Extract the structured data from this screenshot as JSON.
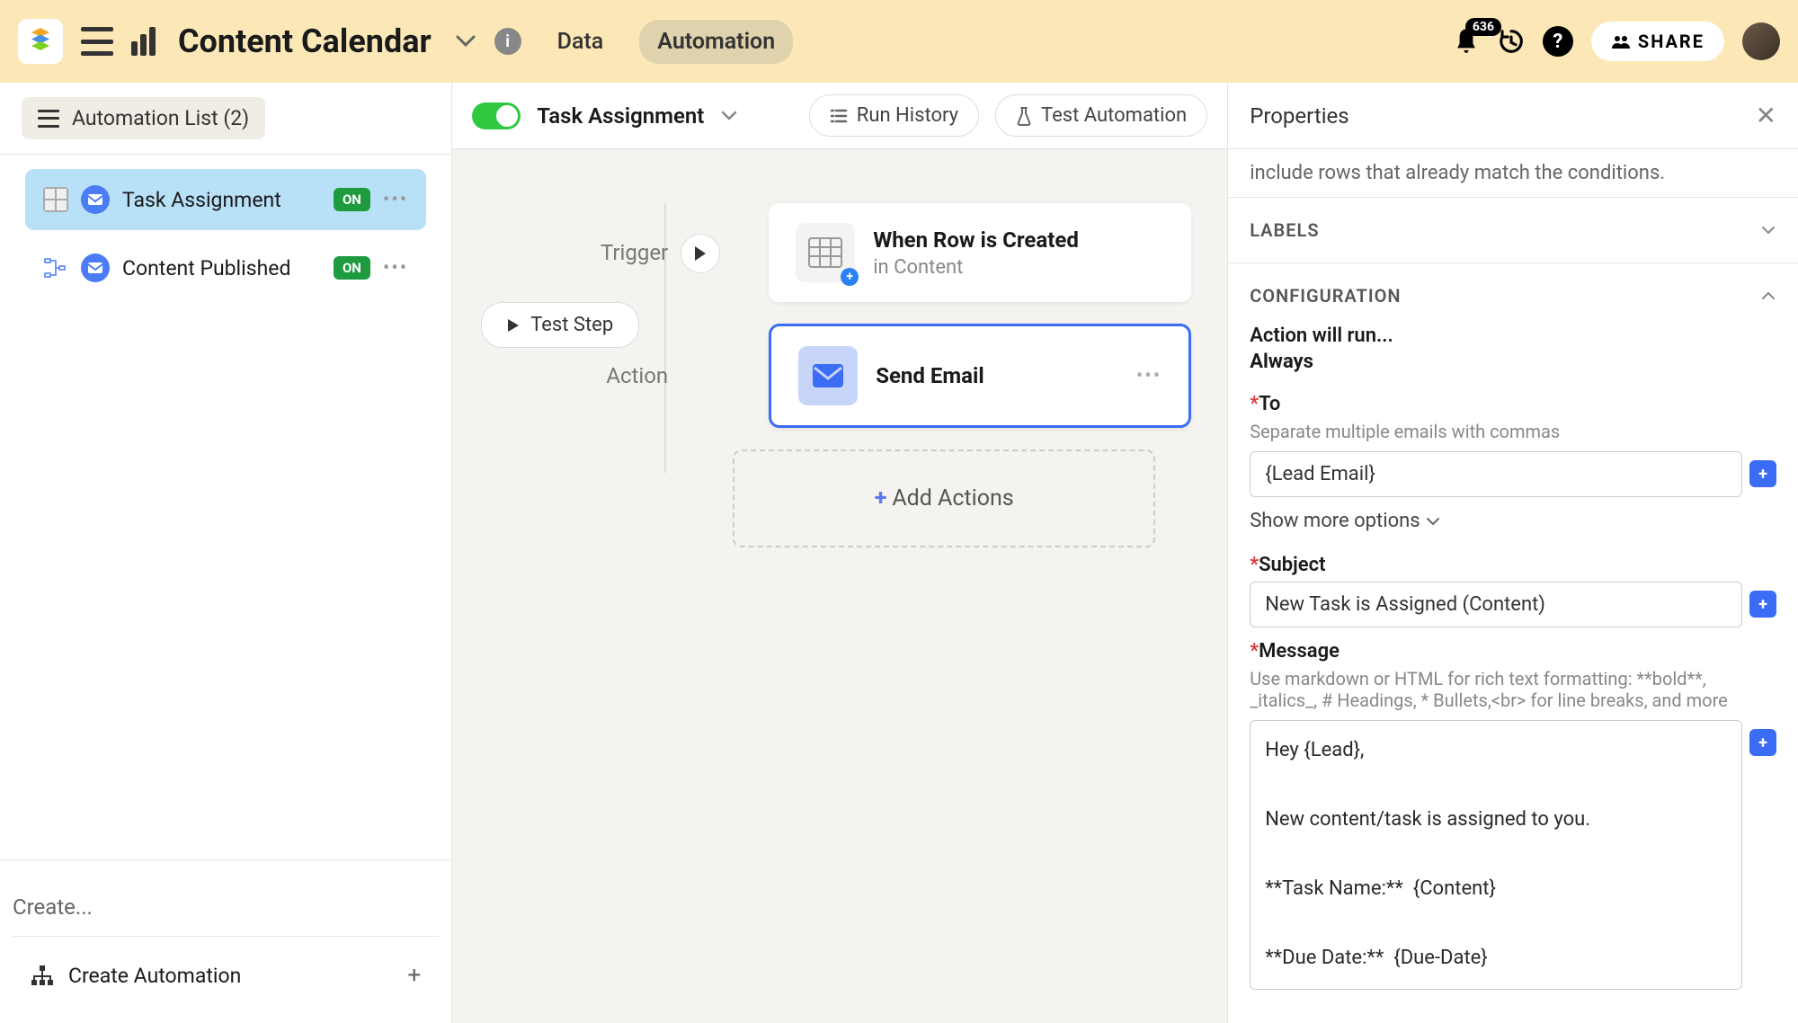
{
  "header": {
    "title": "Content Calendar",
    "nav_data": "Data",
    "nav_automation": "Automation",
    "notification_count": "636",
    "share_label": "SHARE"
  },
  "sidebar": {
    "title": "Automation List (2)",
    "items": [
      {
        "label": "Task Assignment",
        "status": "ON"
      },
      {
        "label": "Content Published",
        "status": "ON"
      }
    ],
    "create_placeholder": "Create...",
    "create_automation": "Create Automation"
  },
  "canvas": {
    "automation_name": "Task Assignment",
    "run_history": "Run History",
    "test_automation": "Test Automation",
    "trigger_label": "Trigger",
    "action_label": "Action",
    "test_step": "Test Step",
    "trigger_card_title": "When Row is Created",
    "trigger_card_sub": "in Content",
    "action_card_title": "Send Email",
    "add_actions": "Add Actions"
  },
  "properties": {
    "title": "Properties",
    "hint_text": "include rows that already match the conditions.",
    "labels_section": "LABELS",
    "config_section": "CONFIGURATION",
    "action_will_run": "Action will run...",
    "action_when": "Always",
    "to_label": "To",
    "to_hint": "Separate multiple emails with commas",
    "to_value": "{Lead Email}",
    "show_more": "Show more options",
    "subject_label": "Subject",
    "subject_value": "New Task is Assigned (Content)",
    "message_label": "Message",
    "message_hint": "Use markdown or HTML for rich text formatting: **bold**, _italics_, # Headings, * Bullets,<br> for line breaks, and more",
    "message_value": "Hey {Lead},\n\nNew content/task is assigned to you.\n\n**Task Name:**  {Content}\n\n**Due Date:**  {Due-Date}"
  }
}
